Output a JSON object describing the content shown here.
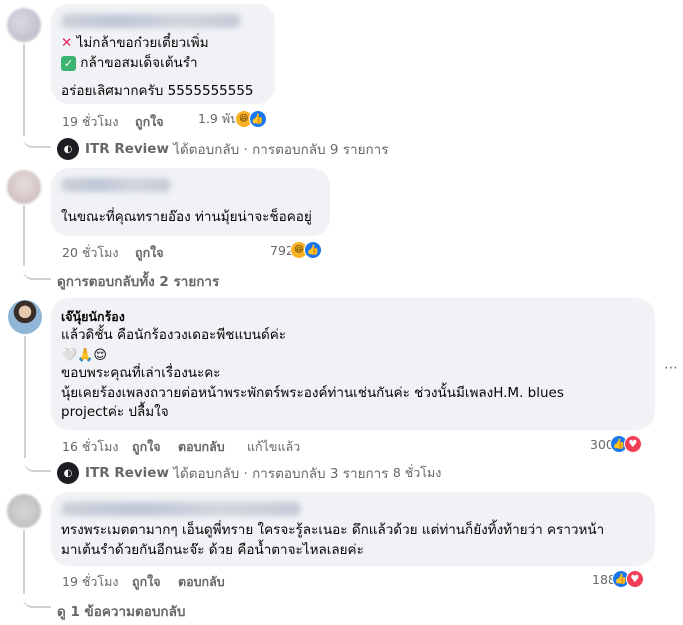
{
  "comments": [
    {
      "lines": [
        "ไม่กล้าขอก๋วยเตี๋ยวเพิ่ม",
        "กล้าขอสมเด็จเต้นรำ",
        "อร่อยเลิศมากครับ 5555555555"
      ],
      "time": "19 ชั่วโมง",
      "like": "ถูกใจ",
      "reactions_count": "1.9 พัน",
      "reply_author": "ITR Review",
      "reply_text": "ได้ตอบกลับ · การตอบกลับ 9 รายการ"
    },
    {
      "lines": [
        "ในขณะที่คุณทรายอ๊อง ท่านมุ้ยน่าจะช็อคอยู่"
      ],
      "time": "20 ชั่วโมง",
      "like": "ถูกใจ",
      "reactions_count": "792",
      "view_replies": "ดูการตอบกลับทั้ง 2 รายการ"
    },
    {
      "author": "เจ๊นุ้ยนักร้อง",
      "lines": [
        "แล้วดิชั้น คือนักร้องวงเดอะพีชแบนด์ค่ะ",
        "ขอบพระคุณที่เล่าเรื่องนะคะ",
        "นุ้ยเคยร้องเพลงถวายต่อหน้าพระพักตร์พระองค์ท่านเช่นกันค่ะ ช่วงนั้นมีเพลงH.M. blues",
        "projectค่ะ ปลื้มใจ"
      ],
      "emoji_line": "🤍🙏😌",
      "time": "16 ชั่วโมง",
      "like": "ถูกใจ",
      "reply": "ตอบกลับ",
      "edited": "แก้ไขแล้ว",
      "reactions_count": "300",
      "reply_author": "ITR Review",
      "reply_text": "ได้ตอบกลับ · การตอบกลับ 3 รายการ",
      "reply_time": "8 ชั่วโมง"
    },
    {
      "lines": [
        "ทรงพระเมตตามากๆ เอ็นดูพี่ทราย ใครจะรู้ละเนอะ ดึกแล้วด้วย แต่ท่านก็ยังทิ้งท้ายว่า คราวหน้า",
        "มาเต้นรำด้วยกันอีกนะจ๊ะ ด้วย คือน้ำตาจะไหลเลยค่ะ"
      ],
      "time": "19 ชั่วโมง",
      "like": "ถูกใจ",
      "reply": "ตอบกลับ",
      "reactions_count": "188",
      "view_replies": "ดู 1 ข้อความตอบกลับ"
    }
  ],
  "more_icon": "more-horizontal-icon",
  "colors": {
    "like": "#1877f2",
    "love": "#f33e58",
    "haha": "#f7b125",
    "bubble": "#f0f2f5",
    "meta": "#65676b"
  }
}
